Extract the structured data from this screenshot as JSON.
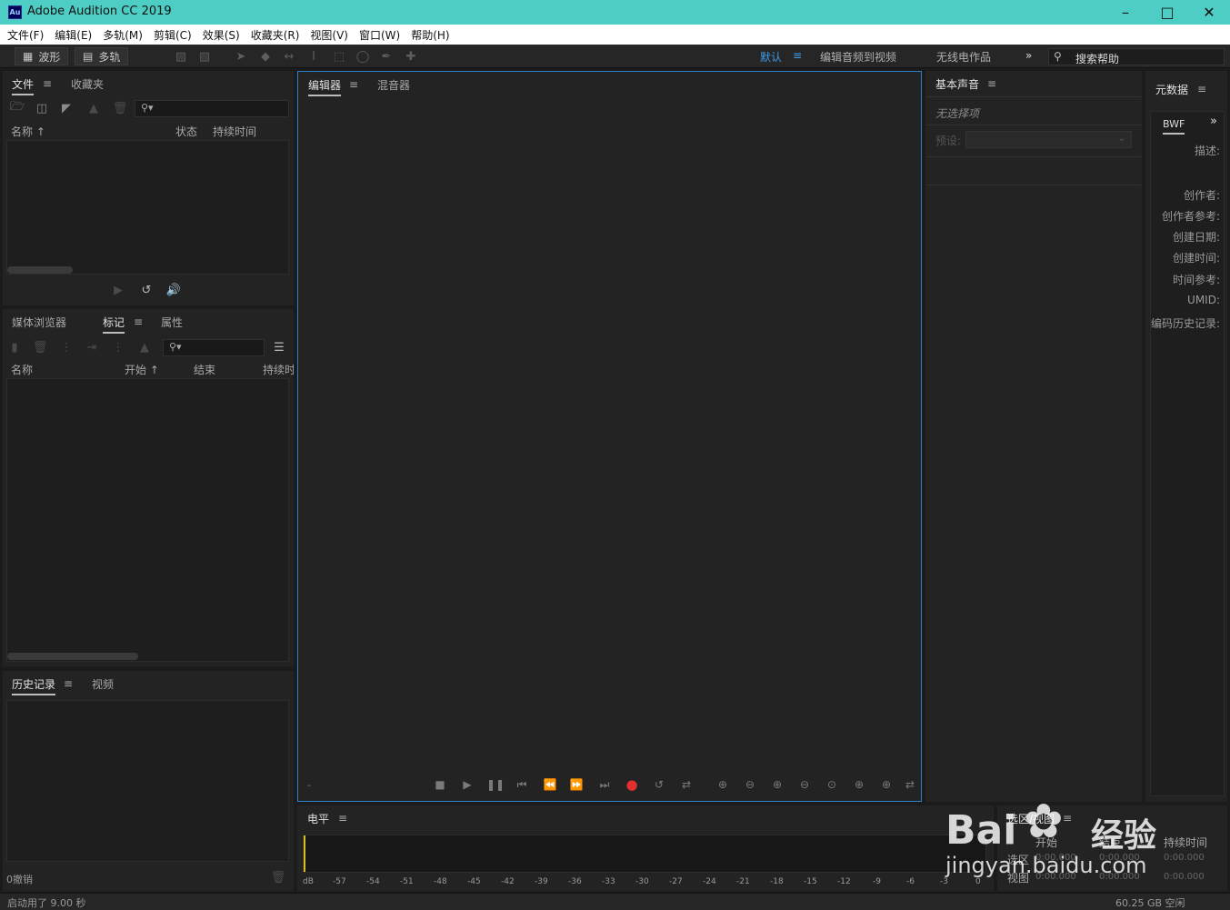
{
  "window": {
    "app_icon": "Au",
    "title": "Adobe Audition CC 2019"
  },
  "menu": [
    "文件(F)",
    "编辑(E)",
    "多轨(M)",
    "剪辑(C)",
    "效果(S)",
    "收藏夹(R)",
    "视图(V)",
    "窗口(W)",
    "帮助(H)"
  ],
  "toolbar": {
    "waveform_label": "波形",
    "multitrack_label": "多轨",
    "workspaces": {
      "default": "默认",
      "edit_video": "编辑音频到视频",
      "radio": "无线电作品"
    },
    "search_placeholder": "搜索帮助"
  },
  "files_panel": {
    "tabs": {
      "files": "文件",
      "favorites": "收藏夹"
    },
    "columns": {
      "name": "名称 ↑",
      "status": "状态",
      "duration": "持续时间"
    }
  },
  "markers_panel": {
    "tabs": {
      "media_browser": "媒体浏览器",
      "markers": "标记",
      "properties": "属性"
    },
    "columns": {
      "name": "名称",
      "start": "开始 ↑",
      "end": "结束",
      "duration": "持续时"
    }
  },
  "history_panel": {
    "tabs": {
      "history": "历史记录",
      "video": "视频"
    },
    "undo_count": "0撤销"
  },
  "editor_panel": {
    "tabs": {
      "editor": "编辑器",
      "mixer": "混音器"
    },
    "timecode": "-"
  },
  "essential_sound": {
    "title": "基本声音",
    "no_selection": "无选择项",
    "preset_label": "预设:"
  },
  "metadata": {
    "title": "元数据",
    "tab": "BWF",
    "labels": [
      "描述:",
      "创作者:",
      "创作者参考:",
      "创建日期:",
      "创建时间:",
      "时间参考:",
      "UMID:",
      "编码历史记录:"
    ]
  },
  "levels": {
    "title": "电平",
    "ticks": [
      "dB",
      "-57",
      "-54",
      "-51",
      "-48",
      "-45",
      "-42",
      "-39",
      "-36",
      "-33",
      "-30",
      "-27",
      "-24",
      "-21",
      "-18",
      "-15",
      "-12",
      "-9",
      "-6",
      "-3",
      "0"
    ]
  },
  "selection_view": {
    "title": "选区/视图",
    "columns": {
      "start": "开始",
      "end": "结束",
      "duration": "持续时间"
    },
    "rows": [
      {
        "label": "选区",
        "start": "0:00.000",
        "end": "0:00.000",
        "duration": "0:00.000"
      },
      {
        "label": "视图",
        "start": "0:00.000",
        "end": "0:00.000",
        "duration": "0:00.000"
      }
    ]
  },
  "status": {
    "startup": "启动用了 9.00 秒",
    "disk_free": "60.25 GB 空闲"
  },
  "watermark": {
    "brand": "Bai",
    "cn": "经验",
    "url": "jingyan.baidu.com"
  },
  "colors": {
    "titlebar": "#4ecdc4",
    "accent": "#3d9be9",
    "record": "#e03030",
    "panel": "#232323"
  }
}
